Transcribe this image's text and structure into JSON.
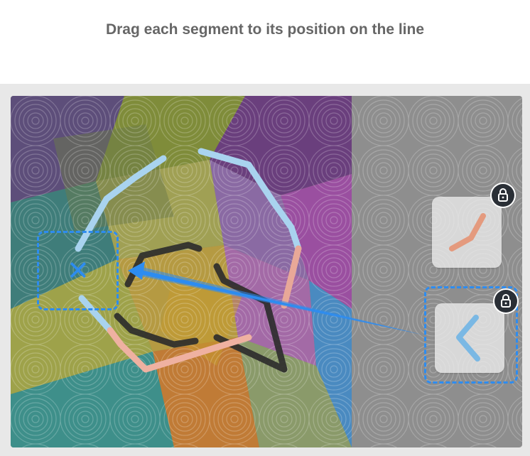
{
  "title": "Drag each segment to its position on the line",
  "colors": {
    "accent": "#2d8cf0",
    "lock_bg": "#2a2f36",
    "frame_bg": "#e8e8e8",
    "title_text": "#666666"
  },
  "pieces": [
    {
      "name": "segment-piece-1",
      "shape": "check-stroke",
      "color": "#e49a7e",
      "locked": true,
      "icon": "lock-icon"
    },
    {
      "name": "segment-piece-2",
      "shape": "left-chevron",
      "color": "#7ab8e4",
      "locked": true,
      "icon": "lock-icon",
      "selected": true
    }
  ],
  "target": {
    "icon": "x-icon",
    "glyph": "✕"
  },
  "drag_arrow": {
    "icon": "arrow-icon"
  }
}
